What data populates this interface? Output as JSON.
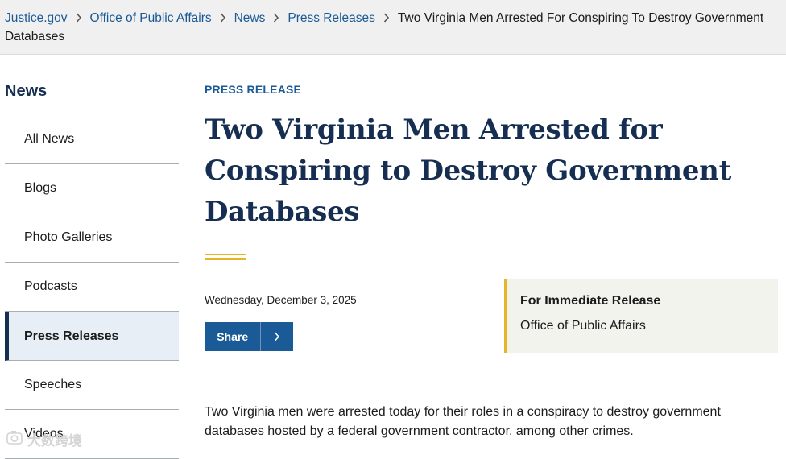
{
  "breadcrumb": {
    "items": [
      "Justice.gov",
      "Office of Public Affairs",
      "News",
      "Press Releases"
    ],
    "current": "Two Virginia Men Arrested For Conspiring To Destroy Government Databases"
  },
  "sidebar": {
    "title": "News",
    "items": [
      {
        "label": "All News"
      },
      {
        "label": "Blogs"
      },
      {
        "label": "Photo Galleries"
      },
      {
        "label": "Podcasts"
      },
      {
        "label": "Press Releases",
        "active": true
      },
      {
        "label": "Speeches"
      },
      {
        "label": "Videos"
      }
    ]
  },
  "article": {
    "eyebrow": "PRESS RELEASE",
    "title": "Two Virginia Men Arrested for Conspiring to Destroy Government Databases",
    "date": "Wednesday, December 3, 2025",
    "share_label": "Share",
    "release_heading": "For Immediate Release",
    "release_office": "Office of Public Affairs",
    "lede": "Two Virginia men were arrested today for their roles in a conspiracy to destroy government databases hosted by a federal government contractor, among other crimes."
  },
  "watermark": {
    "text": "大数跨境",
    "icon": "camera-logo-icon"
  },
  "colors": {
    "link": "#1a5a96",
    "navy": "#162e51",
    "gold": "#e5b52a",
    "active_bg": "#e7eef6"
  }
}
